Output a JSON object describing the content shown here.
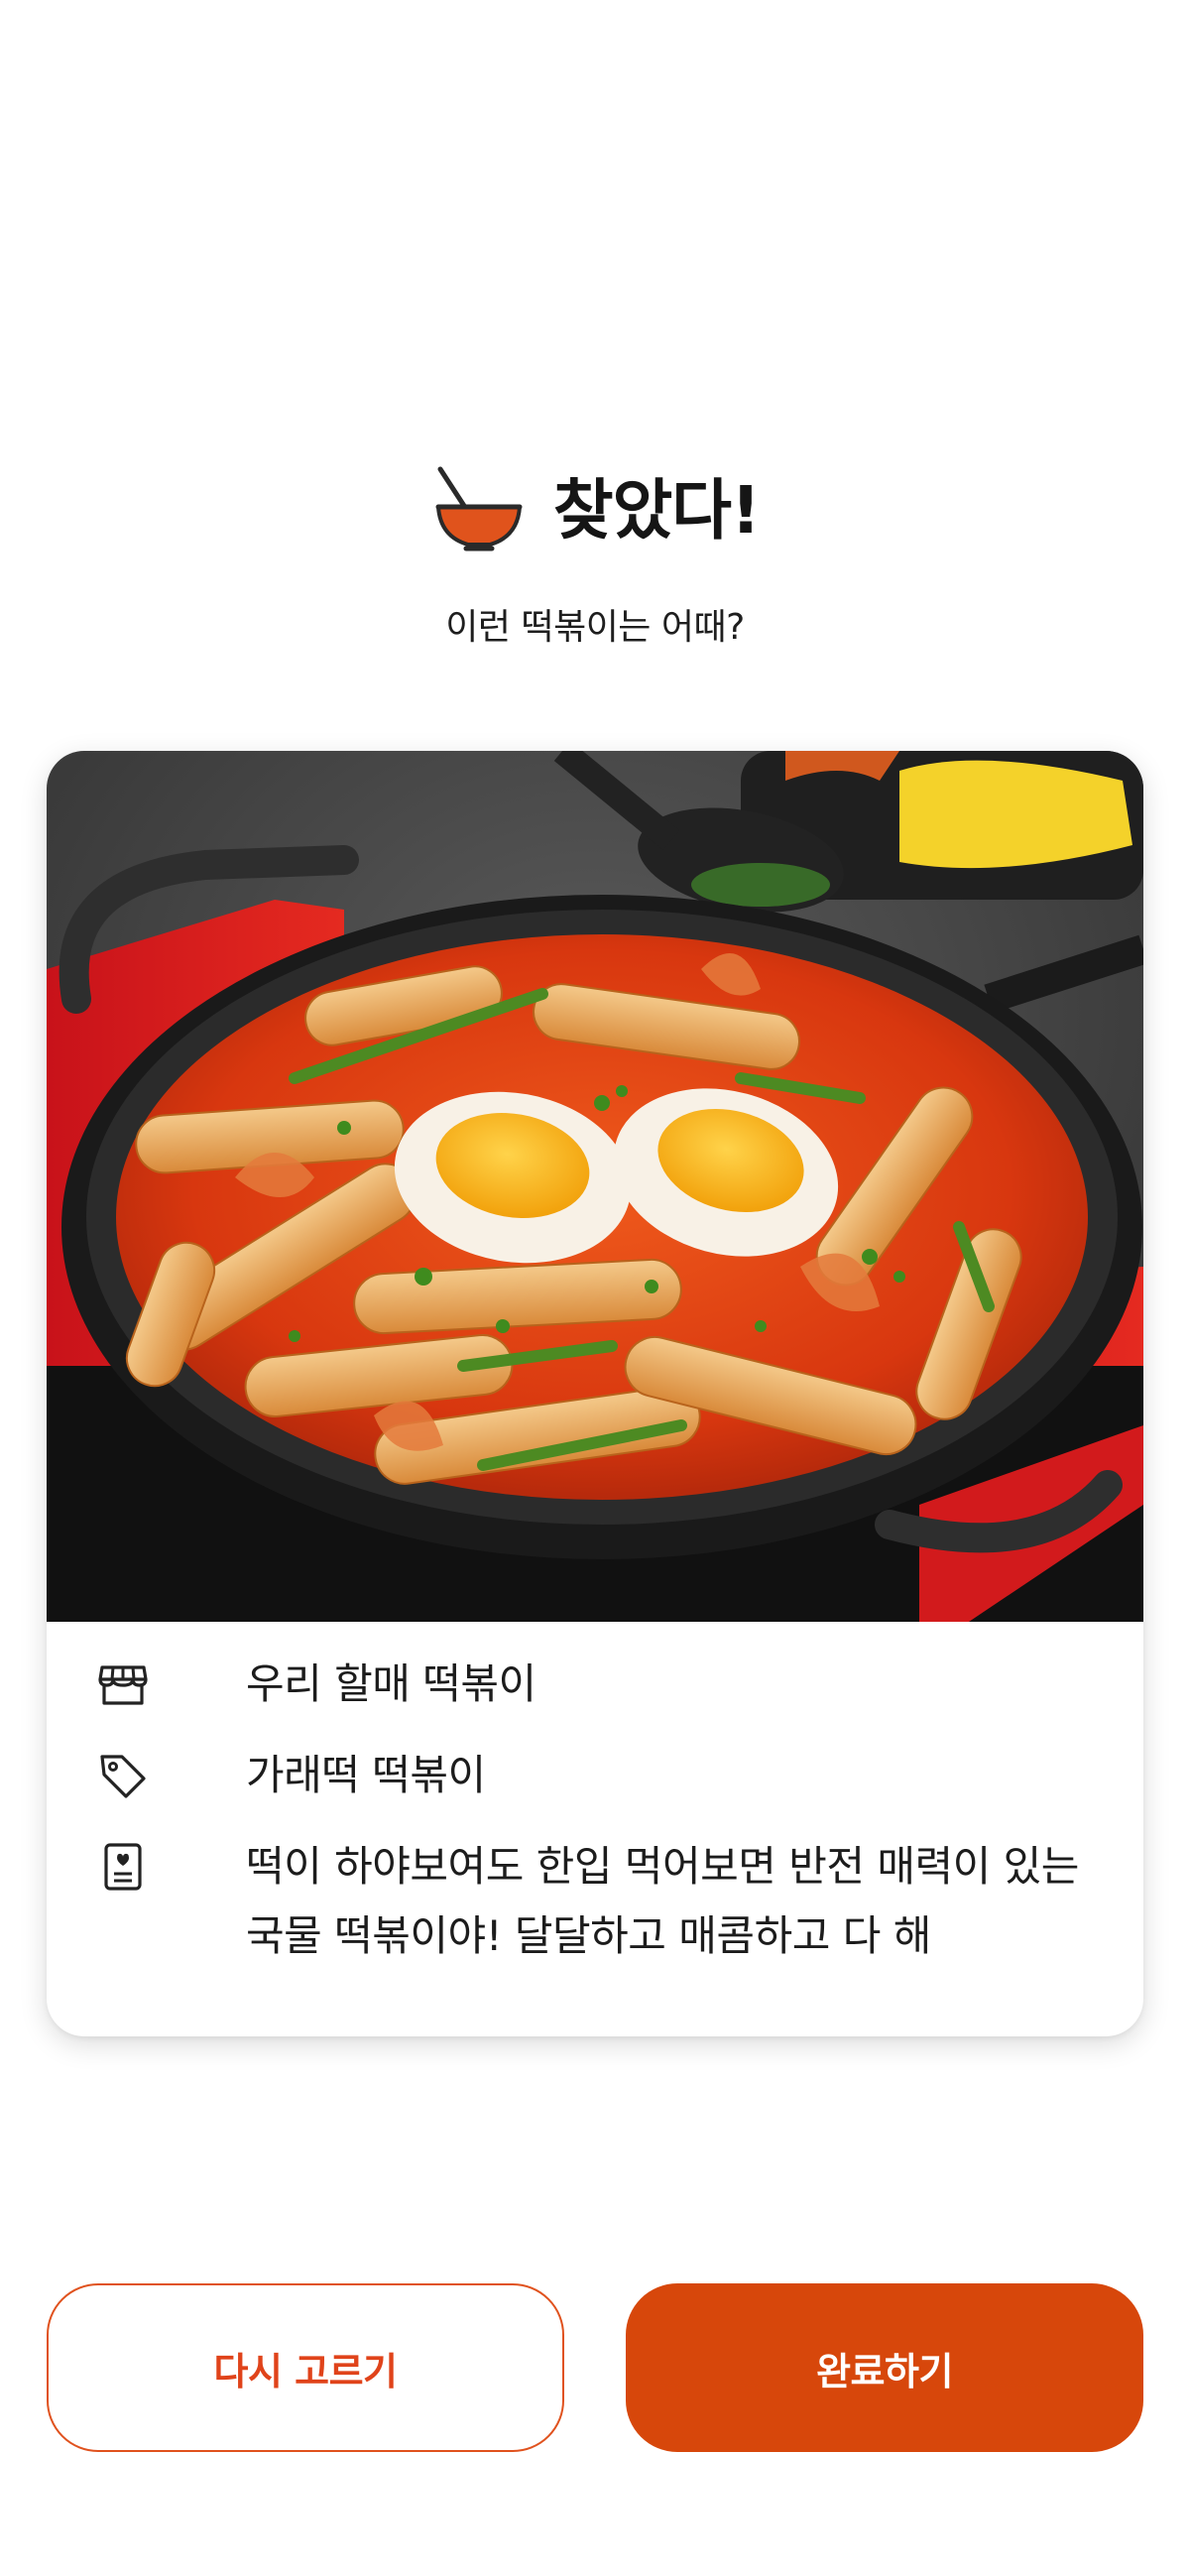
{
  "header": {
    "icon": "bowl-with-spoon-icon",
    "title": "찾았다!",
    "subtitle": "이런 떡볶이는 어때?"
  },
  "result_card": {
    "photo": "tteokbokki-pan-photo",
    "store": {
      "icon": "store-icon",
      "label": "우리 할매 떡볶이"
    },
    "category": {
      "icon": "tag-icon",
      "label": "가래떡 떡볶이"
    },
    "description": {
      "icon": "memo-icon",
      "label": "떡이 하야보여도 한입 먹어보면 반전 매력이 있는 국물 떡볶이야! 달달하고 매콤하고 다 해"
    }
  },
  "actions": {
    "retry_label": "다시 고르기",
    "done_label": "완료하기"
  },
  "colors": {
    "accent": "#d7470b",
    "accent_text": "#e0431a",
    "bowl": "#e0531c"
  }
}
